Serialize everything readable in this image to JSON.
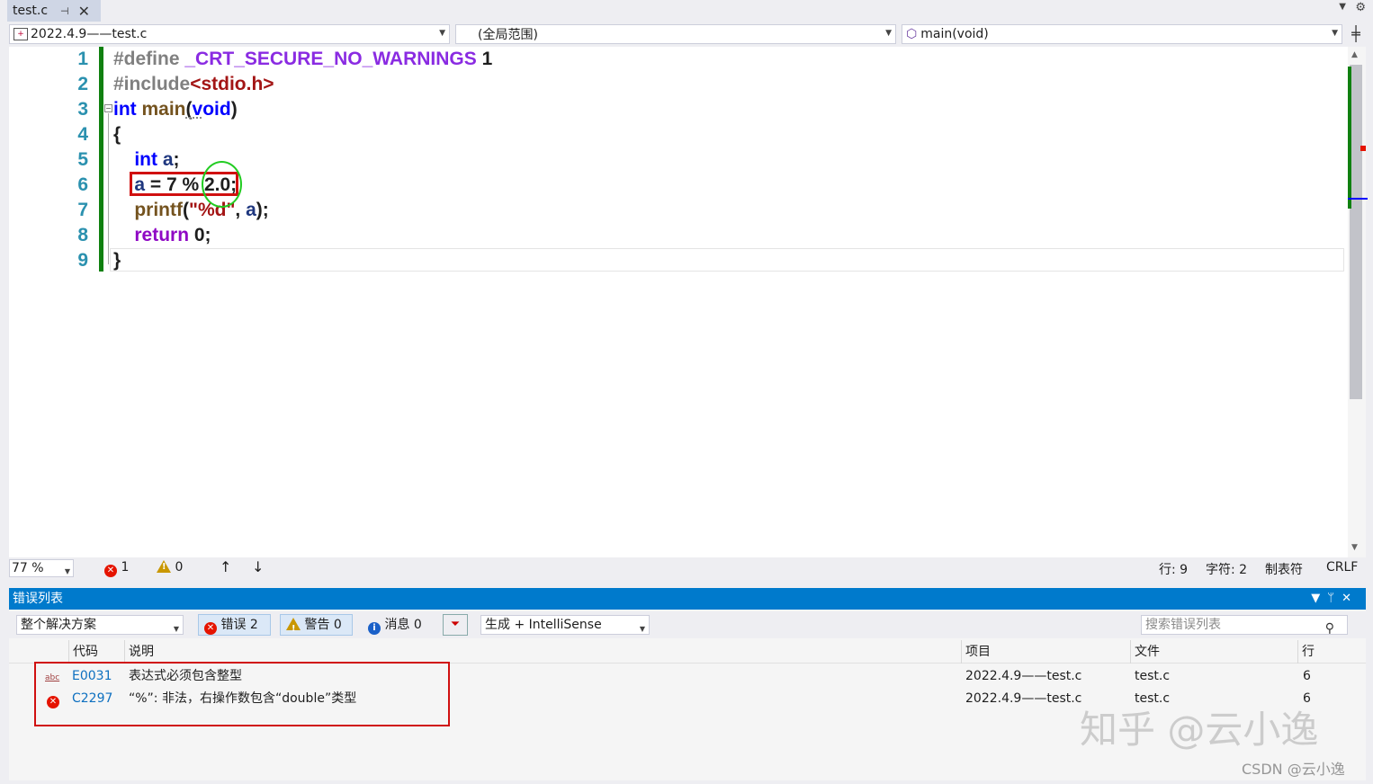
{
  "tab": {
    "title": "test.c",
    "pin": "⊣",
    "close": "✕"
  },
  "nav": {
    "project": "2022.4.9——test.c",
    "scope": "(全局范围)",
    "function": "main(void)"
  },
  "editor": {
    "line_numbers": [
      "1",
      "2",
      "3",
      "4",
      "5",
      "6",
      "7",
      "8",
      "9"
    ],
    "lines": [
      [
        [
          "pp",
          "#define "
        ],
        [
          "mac",
          "_CRT_SECURE_NO_WARNINGS"
        ],
        [
          "pl",
          " 1"
        ]
      ],
      [
        [
          "pp",
          "#include"
        ],
        [
          "inc",
          "<stdio.h>"
        ]
      ],
      [
        [
          "kw",
          "int"
        ],
        [
          "pl",
          " "
        ],
        [
          "fn",
          "main"
        ],
        [
          "pl",
          "("
        ],
        [
          "kw",
          "void"
        ],
        [
          "pl",
          ")"
        ]
      ],
      [
        [
          "pl",
          "{"
        ]
      ],
      [
        [
          "pl",
          "    "
        ],
        [
          "kw",
          "int"
        ],
        [
          "pl",
          " "
        ],
        [
          "var",
          "a"
        ],
        [
          "pl",
          ";"
        ]
      ],
      [
        [
          "pl",
          "    "
        ],
        [
          "var",
          "a"
        ],
        [
          "pl",
          " = 7 % 2.0;"
        ]
      ],
      [
        [
          "pl",
          "    "
        ],
        [
          "fn",
          "printf"
        ],
        [
          "pl",
          "("
        ],
        [
          "str",
          "\"%d\""
        ],
        [
          "pl",
          ", "
        ],
        [
          "var",
          "a"
        ],
        [
          "pl",
          ");"
        ]
      ],
      [
        [
          "pl",
          "    "
        ],
        [
          "ctl",
          "return"
        ],
        [
          "pl",
          " 0;"
        ]
      ],
      [
        [
          "pl",
          "}"
        ]
      ]
    ]
  },
  "status": {
    "zoom": "77 %",
    "errors": "1",
    "warnings": "0",
    "line": "行: 9",
    "char": "字符: 2",
    "indent": "制表符",
    "eol": "CRLF"
  },
  "error_list": {
    "title": "错误列表",
    "scope": "整个解决方案",
    "errors_btn": "错误 2",
    "warnings_btn": "警告 0",
    "messages_btn": "消息 0",
    "build_source": "生成 + IntelliSense",
    "search_placeholder": "搜索错误列表",
    "columns": {
      "code": "代码",
      "desc": "说明",
      "project": "项目",
      "file": "文件",
      "line": "行"
    },
    "rows": [
      {
        "code": "E0031",
        "desc": "表达式必须包含整型",
        "project": "2022.4.9——test.c",
        "file": "test.c",
        "line": "6"
      },
      {
        "code": "C2297",
        "desc": "“%”: 非法，右操作数包含“double”类型",
        "project": "2022.4.9——test.c",
        "file": "test.c",
        "line": "6"
      }
    ]
  },
  "watermark": {
    "zhihu": "知乎 @云小逸",
    "csdn": "CSDN @云小逸"
  }
}
